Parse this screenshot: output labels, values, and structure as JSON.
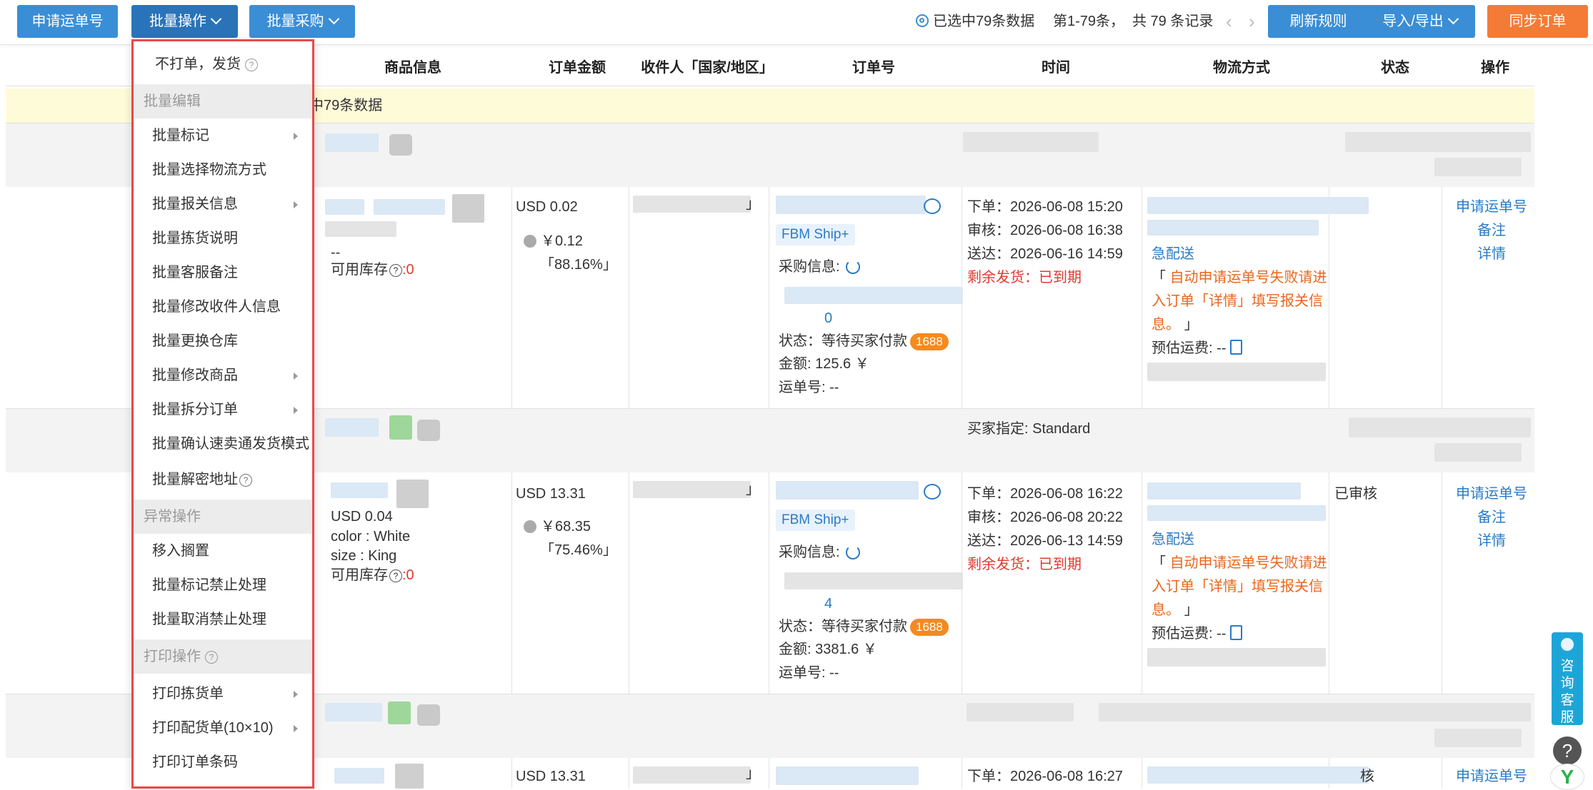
{
  "toolbar": {
    "apply_tracking": "申请运单号",
    "batch_ops": "批量操作",
    "batch_purchase": "批量采购",
    "selected_info": "已选中79条数据",
    "range_info": "第1-79条，",
    "total_info": "共 79 条记录",
    "prev": "‹",
    "next": "›",
    "refresh_rules": "刷新规则",
    "import_export": "导入/导出",
    "sync_orders": "同步订单"
  },
  "table": {
    "headers": [
      "商品信息",
      "订单金额",
      "收件人「国家/地区」",
      "订单号",
      "时间",
      "物流方式",
      "状态",
      "操作"
    ],
    "selected_banner": "中79条数据"
  },
  "dropdown": {
    "top_item": "不打单，发货",
    "sections": [
      {
        "title": "批量编辑",
        "items": [
          {
            "label": "批量标记",
            "submenu": true
          },
          {
            "label": "批量选择物流方式",
            "submenu": false
          },
          {
            "label": "批量报关信息",
            "submenu": true
          },
          {
            "label": "批量拣货说明",
            "submenu": false
          },
          {
            "label": "批量客服备注",
            "submenu": false
          },
          {
            "label": "批量修改收件人信息",
            "submenu": false
          },
          {
            "label": "批量更换仓库",
            "submenu": false
          },
          {
            "label": "批量修改商品",
            "submenu": true
          },
          {
            "label": "批量拆分订单",
            "submenu": true
          },
          {
            "label": "批量确认速卖通发货模式",
            "submenu": false
          },
          {
            "label": "批量解密地址",
            "submenu": false
          }
        ]
      },
      {
        "title": "异常操作",
        "items": [
          {
            "label": "移入搁置",
            "submenu": false
          },
          {
            "label": "批量标记禁止处理",
            "submenu": false
          },
          {
            "label": "批量取消禁止处理",
            "submenu": false
          }
        ]
      },
      {
        "title": "打印操作",
        "items": [
          {
            "label": "打印拣货单",
            "submenu": true
          },
          {
            "label": "打印配货单(10×10)",
            "submenu": true
          },
          {
            "label": "打印订单条码",
            "submenu": false
          }
        ]
      }
    ]
  },
  "orders": [
    {
      "product_price": "--",
      "stock_label": "可用库存",
      "stock_value": ":0",
      "amount": "USD 0.02",
      "cny": "￥0.12",
      "ratio": "「88.16%」",
      "recipient_suffix": "」",
      "fbm_tag": "FBM Ship+",
      "purchase_label": "采购信息:",
      "order_num_tail": "0",
      "status_label": "状态：等待买家付款",
      "badge": "1688",
      "money_label": "金额:   125.6 ￥",
      "tracking_label": "运单号: --",
      "time_order": "下单：2026-06-08 15:20",
      "time_review": "审核：2026-06-08 16:38",
      "time_deliver": "送达：2026-06-16 14:59",
      "time_remaining": "剩余发货：已到期",
      "logistics_link": "急配送",
      "logistics_bracket_open": "「",
      "logistics_warn_1": "自动申请运单号失败请进",
      "logistics_warn_2": "入订单「详情」填写报关信",
      "logistics_warn_3": "息。",
      "logistics_bracket_close": "」",
      "est_fee": "预估运费: --",
      "status": "",
      "op_apply": "申请运单号",
      "op_note": "备注",
      "op_detail": "详情"
    },
    {
      "group_buyer": "买家指定:   Standard",
      "product_price": "USD 0.04",
      "color": "color   :  White",
      "size": "size   :  King",
      "stock_label": "可用库存",
      "stock_value": ":0",
      "amount": "USD 13.31",
      "cny": "￥68.35",
      "ratio": "「75.46%」",
      "recipient_suffix": "」",
      "fbm_tag": "FBM Ship+",
      "purchase_label": "采购信息:",
      "order_num_tail": "4",
      "status_label": "状态：等待买家付款",
      "badge": "1688",
      "money_label": "金额:   3381.6 ￥",
      "tracking_label": "运单号: --",
      "time_order": "下单：2026-06-08 16:22",
      "time_review": "审核：2026-06-08 20:22",
      "time_deliver": "送达：2026-06-13 14:59",
      "time_remaining": "剩余发货：已到期",
      "logistics_link": "急配送",
      "logistics_bracket_open": "「",
      "logistics_warn_1": "自动申请运单号失败请进",
      "logistics_warn_2": "入订单「详情」填写报关信",
      "logistics_warn_3": "息。",
      "logistics_bracket_close": "」",
      "est_fee": "预估运费: --",
      "status": "已审核",
      "op_apply": "申请运单号",
      "op_note": "备注",
      "op_detail": "详情"
    },
    {
      "amount": "USD 13.31",
      "recipient_suffix": "」",
      "time_order": "下单：2026-06-08 16:27",
      "status": "核",
      "op_apply": "申请运单号"
    }
  ],
  "widgets": {
    "consult": "咨询客服",
    "help": "?",
    "logo": "Y"
  }
}
